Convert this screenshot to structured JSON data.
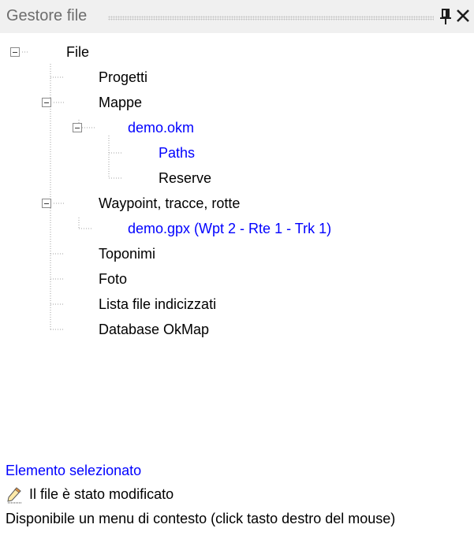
{
  "panel": {
    "title": "Gestore file",
    "icons": {
      "pin": "pin-icon",
      "close": "close-icon"
    }
  },
  "tree": {
    "root": "File",
    "progetti": "Progetti",
    "mappe": "Mappe",
    "demo_okm": "demo.okm",
    "paths": "Paths",
    "reserve": "Reserve",
    "waypoint": "Waypoint, tracce, rotte",
    "demo_gpx": "demo.gpx (Wpt 2 - Rte 1 - Trk 1)",
    "toponimi": "Toponimi",
    "foto": "Foto",
    "lista_file": "Lista file indicizzati",
    "database": "Database OkMap"
  },
  "footer": {
    "selected_label": "Elemento selezionato",
    "modified_label": "Il file è stato modificato",
    "context_hint": "Disponibile un menu di contesto (click tasto destro del mouse)",
    "modified_icon": "pencil-icon"
  },
  "colors": {
    "link": "#0000ff",
    "text": "#000000",
    "title_text": "#6d6d6d",
    "title_bg": "#f0f0f0",
    "tree_line": "#a0a0a0"
  }
}
